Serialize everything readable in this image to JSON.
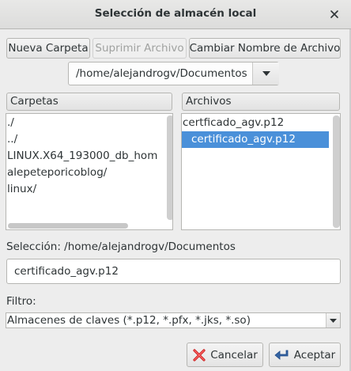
{
  "window": {
    "title": "Selección de almacén local",
    "close_icon": "close-icon"
  },
  "toolbar": {
    "new_folder": "Nueva Carpeta",
    "delete_file": "Suprimir Archivo",
    "rename_file": "Cambiar Nombre de Archivo",
    "delete_file_enabled": false
  },
  "path": {
    "value": "/home/alejandrogv/Documentos",
    "arrow_icon": "chevron-down-icon"
  },
  "folders": {
    "header": "Carpetas",
    "items": [
      "./",
      "../",
      "LINUX.X64_193000_db_hom",
      "alepeteporicoblog/",
      "linux/"
    ]
  },
  "files": {
    "header": "Archivos",
    "items": [
      "certficado_agv.p12",
      "certificado_agv.p12"
    ],
    "selected_index": 1
  },
  "selection": {
    "label": "Selección: /home/alejandrogv/Documentos",
    "value": "certificado_agv.p12"
  },
  "filter": {
    "label": "Filtro:",
    "value": "Almacenes de claves (*.p12, *.pfx, *.jks, *.so)"
  },
  "actions": {
    "cancel": "Cancelar",
    "cancel_icon": "cancel-x-icon",
    "accept": "Aceptar",
    "accept_icon": "accept-arrow-icon"
  },
  "colors": {
    "selection": "#4a90d9",
    "cancel_icon": "#cc2222",
    "accept_icon": "#3465a4"
  }
}
